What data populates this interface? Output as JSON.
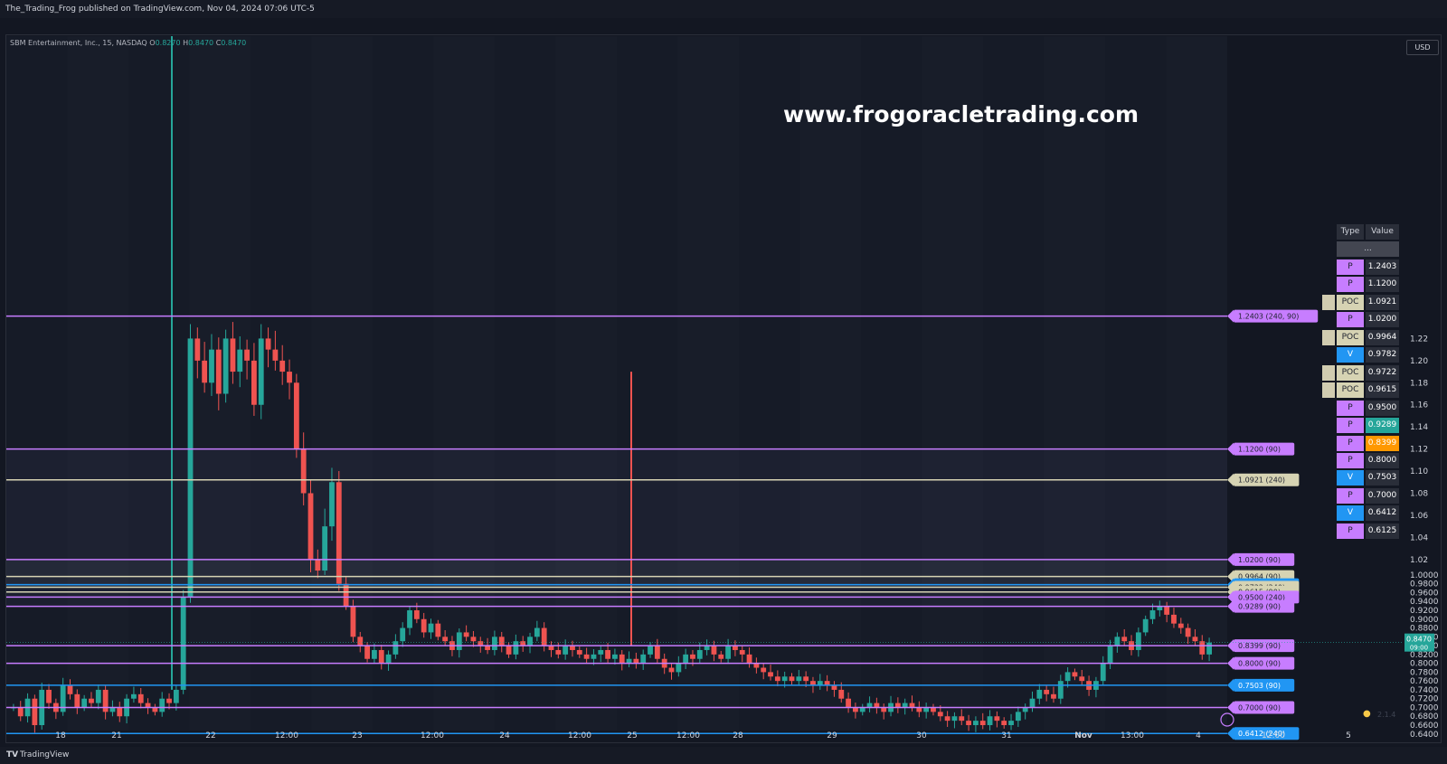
{
  "header": {
    "publisher": "The_Trading_Frog published on TradingView.com, Nov 04, 2024 07:06 UTC-5"
  },
  "legend": {
    "symbol": "SBM Entertainment, Inc., 15, NASDAQ",
    "o": "O",
    "o_val": "0.8270",
    "h": "H",
    "h_val": "0.8470",
    "c": "C",
    "c_val": "0.8470"
  },
  "watermark": "www.frogoracletrading.com",
  "currency": "USD",
  "footer": {
    "brand": "TradingView",
    "logo": "TV"
  },
  "status": {
    "version": "2.1.4",
    "icon": "frog-icon"
  },
  "colors": {
    "background": "#131722",
    "up": "#26a69a",
    "down": "#ef5350",
    "pivot": "#c77dff",
    "poc": "#d6d3b3",
    "volume": "#2196f3",
    "highlight_teal": "#26a69a",
    "highlight_orange": "#ff9800"
  },
  "chart_data": {
    "type": "candlestick",
    "title": "",
    "xlabel": "",
    "ylabel": "",
    "y_ticks": [
      "1.22",
      "1.20",
      "1.18",
      "1.16",
      "1.14",
      "1.12",
      "1.10",
      "1.08",
      "1.06",
      "1.04",
      "1.02",
      "1.0000",
      "0.9800",
      "0.9600",
      "0.9400",
      "0.9200",
      "0.9000",
      "0.8800",
      "0.8600",
      "0.8400",
      "0.8200",
      "0.8000",
      "0.7800",
      "0.7600",
      "0.7400",
      "0.7200",
      "0.7000",
      "0.6800",
      "0.6600",
      "0.6400"
    ],
    "x_ticks": [
      "18",
      "21",
      "22",
      "12:00",
      "23",
      "12:00",
      "24",
      "12:00",
      "25",
      "12:00",
      "28",
      "29",
      "30",
      "31",
      "Nov",
      "13:00",
      "4",
      "12:00",
      "5"
    ],
    "last_price": {
      "value": "0.8470",
      "time": "09:00"
    },
    "levels": [
      {
        "label": "1.2403 (240, 90)",
        "price": 1.2403,
        "kind": "pivot"
      },
      {
        "label": "1.1200 (90)",
        "price": 1.12,
        "kind": "pivot"
      },
      {
        "label": "1.0921 (240)",
        "price": 1.0921,
        "kind": "poc"
      },
      {
        "label": "1.0200 (90)",
        "price": 1.02,
        "kind": "pivot"
      },
      {
        "label": "0.9964 (90)",
        "price": 0.9964,
        "kind": "poc"
      },
      {
        "label": "0.9782 (240)",
        "price": 0.9782,
        "kind": "volume"
      },
      {
        "label": "0.9722 (240)",
        "price": 0.9722,
        "kind": "poc"
      },
      {
        "label": "0.9615 (90)",
        "price": 0.9615,
        "kind": "poc"
      },
      {
        "label": "0.9500 (240)",
        "price": 0.95,
        "kind": "pivot"
      },
      {
        "label": "0.9289 (90)",
        "price": 0.9289,
        "kind": "pivot"
      },
      {
        "label": "0.8399 (90)",
        "price": 0.8399,
        "kind": "pivot"
      },
      {
        "label": "0.8000 (90)",
        "price": 0.8,
        "kind": "pivot"
      },
      {
        "label": "0.7503 (90)",
        "price": 0.7503,
        "kind": "volume"
      },
      {
        "label": "0.7000 (90)",
        "price": 0.7,
        "kind": "pivot"
      },
      {
        "label": "0.6412 (240)",
        "price": 0.6412,
        "kind": "volume"
      }
    ],
    "series_close": [
      0.7,
      0.68,
      0.72,
      0.66,
      0.74,
      0.71,
      0.69,
      0.75,
      0.73,
      0.7,
      0.72,
      0.71,
      0.74,
      0.69,
      0.7,
      0.68,
      0.72,
      0.73,
      0.71,
      0.7,
      0.69,
      0.72,
      0.71,
      0.74,
      0.95,
      1.22,
      1.2,
      1.18,
      1.21,
      1.17,
      1.22,
      1.19,
      1.21,
      1.2,
      1.16,
      1.22,
      1.21,
      1.2,
      1.19,
      1.18,
      1.12,
      1.08,
      1.02,
      1.01,
      1.05,
      1.09,
      0.98,
      0.93,
      0.86,
      0.84,
      0.81,
      0.83,
      0.8,
      0.82,
      0.85,
      0.88,
      0.92,
      0.9,
      0.87,
      0.89,
      0.86,
      0.85,
      0.83,
      0.87,
      0.86,
      0.85,
      0.84,
      0.83,
      0.86,
      0.84,
      0.82,
      0.85,
      0.84,
      0.86,
      0.88,
      0.84,
      0.83,
      0.82,
      0.84,
      0.83,
      0.82,
      0.81,
      0.82,
      0.83,
      0.81,
      0.82,
      0.8,
      0.81,
      0.8,
      0.82,
      0.84,
      0.81,
      0.79,
      0.78,
      0.8,
      0.82,
      0.81,
      0.83,
      0.84,
      0.82,
      0.81,
      0.84,
      0.83,
      0.82,
      0.8,
      0.79,
      0.78,
      0.77,
      0.76,
      0.77,
      0.76,
      0.77,
      0.76,
      0.75,
      0.76,
      0.75,
      0.74,
      0.72,
      0.7,
      0.69,
      0.7,
      0.71,
      0.7,
      0.69,
      0.71,
      0.7,
      0.71,
      0.7,
      0.69,
      0.7,
      0.69,
      0.68,
      0.67,
      0.68,
      0.67,
      0.66,
      0.67,
      0.66,
      0.68,
      0.67,
      0.66,
      0.67,
      0.69,
      0.7,
      0.72,
      0.74,
      0.73,
      0.72,
      0.76,
      0.78,
      0.77,
      0.76,
      0.74,
      0.76,
      0.8,
      0.84,
      0.86,
      0.85,
      0.83,
      0.87,
      0.9,
      0.92,
      0.93,
      0.91,
      0.89,
      0.88,
      0.86,
      0.85,
      0.82,
      0.847
    ]
  },
  "table": {
    "headers": {
      "type": "Type",
      "value": "Value"
    },
    "subheader": "...",
    "rows": [
      {
        "type": "P",
        "value": "1.2403",
        "kind": "pivot"
      },
      {
        "type": "P",
        "value": "1.1200",
        "kind": "pivot"
      },
      {
        "type": "POC",
        "value": "1.0921",
        "kind": "poc"
      },
      {
        "type": "P",
        "value": "1.0200",
        "kind": "pivot"
      },
      {
        "type": "POC",
        "value": "0.9964",
        "kind": "poc"
      },
      {
        "type": "V",
        "value": "0.9782",
        "kind": "volume"
      },
      {
        "type": "POC",
        "value": "0.9722",
        "kind": "poc"
      },
      {
        "type": "POC",
        "value": "0.9615",
        "kind": "poc"
      },
      {
        "type": "P",
        "value": "0.9500",
        "kind": "pivot"
      },
      {
        "type": "P",
        "value": "0.9289",
        "kind": "pivot",
        "highlight": "teal"
      },
      {
        "type": "P",
        "value": "0.8399",
        "kind": "pivot",
        "highlight": "orange"
      },
      {
        "type": "P",
        "value": "0.8000",
        "kind": "pivot"
      },
      {
        "type": "V",
        "value": "0.7503",
        "kind": "volume"
      },
      {
        "type": "P",
        "value": "0.7000",
        "kind": "pivot"
      },
      {
        "type": "V",
        "value": "0.6412",
        "kind": "volume"
      },
      {
        "type": "P",
        "value": "0.6125",
        "kind": "pivot"
      }
    ]
  }
}
